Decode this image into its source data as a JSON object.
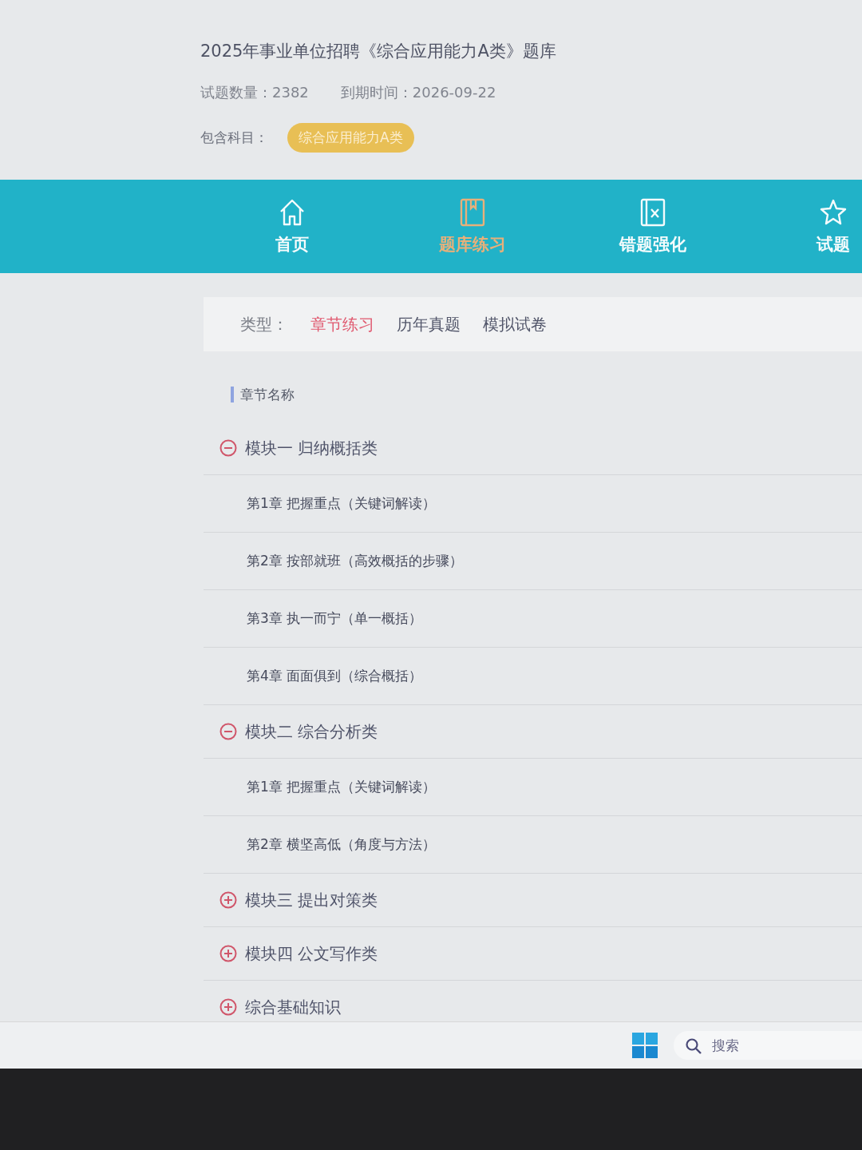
{
  "bank": {
    "title": "2025年事业单位招聘《综合应用能力A类》题库",
    "count_label": "试题数量：",
    "count": "2382",
    "expiry_label": "到期时间：",
    "expiry": "2026-09-22",
    "subjects_label": "包含科目：",
    "subjects": [
      "综合应用能力A类"
    ]
  },
  "nav": [
    {
      "label": "首页",
      "selected": false
    },
    {
      "label": "题库练习",
      "selected": true
    },
    {
      "label": "错题强化",
      "selected": false
    },
    {
      "label": "试题",
      "selected": false
    }
  ],
  "filter": {
    "label": "类型：",
    "options": [
      {
        "label": "章节练习",
        "selected": true
      },
      {
        "label": "历年真题",
        "selected": false
      },
      {
        "label": "模拟试卷",
        "selected": false
      }
    ]
  },
  "section_title": "章节名称",
  "tree": [
    {
      "label": "模块一 归纳概括类",
      "expanded": true,
      "children": [
        {
          "label": "第1章 把握重点（关键词解读）"
        },
        {
          "label": "第2章 按部就班（高效概括的步骤）"
        },
        {
          "label": "第3章 执一而宁（单一概括）"
        },
        {
          "label": "第4章 面面俱到（综合概括）"
        }
      ]
    },
    {
      "label": "模块二 综合分析类",
      "expanded": true,
      "children": [
        {
          "label": "第1章 把握重点（关键词解读）"
        },
        {
          "label": "第2章 横坚高低（角度与方法）"
        }
      ]
    },
    {
      "label": "模块三 提出对策类",
      "expanded": false
    },
    {
      "label": "模块四 公文写作类",
      "expanded": false
    },
    {
      "label": "综合基础知识",
      "expanded": false
    }
  ],
  "taskbar": {
    "search_placeholder": "搜索"
  }
}
